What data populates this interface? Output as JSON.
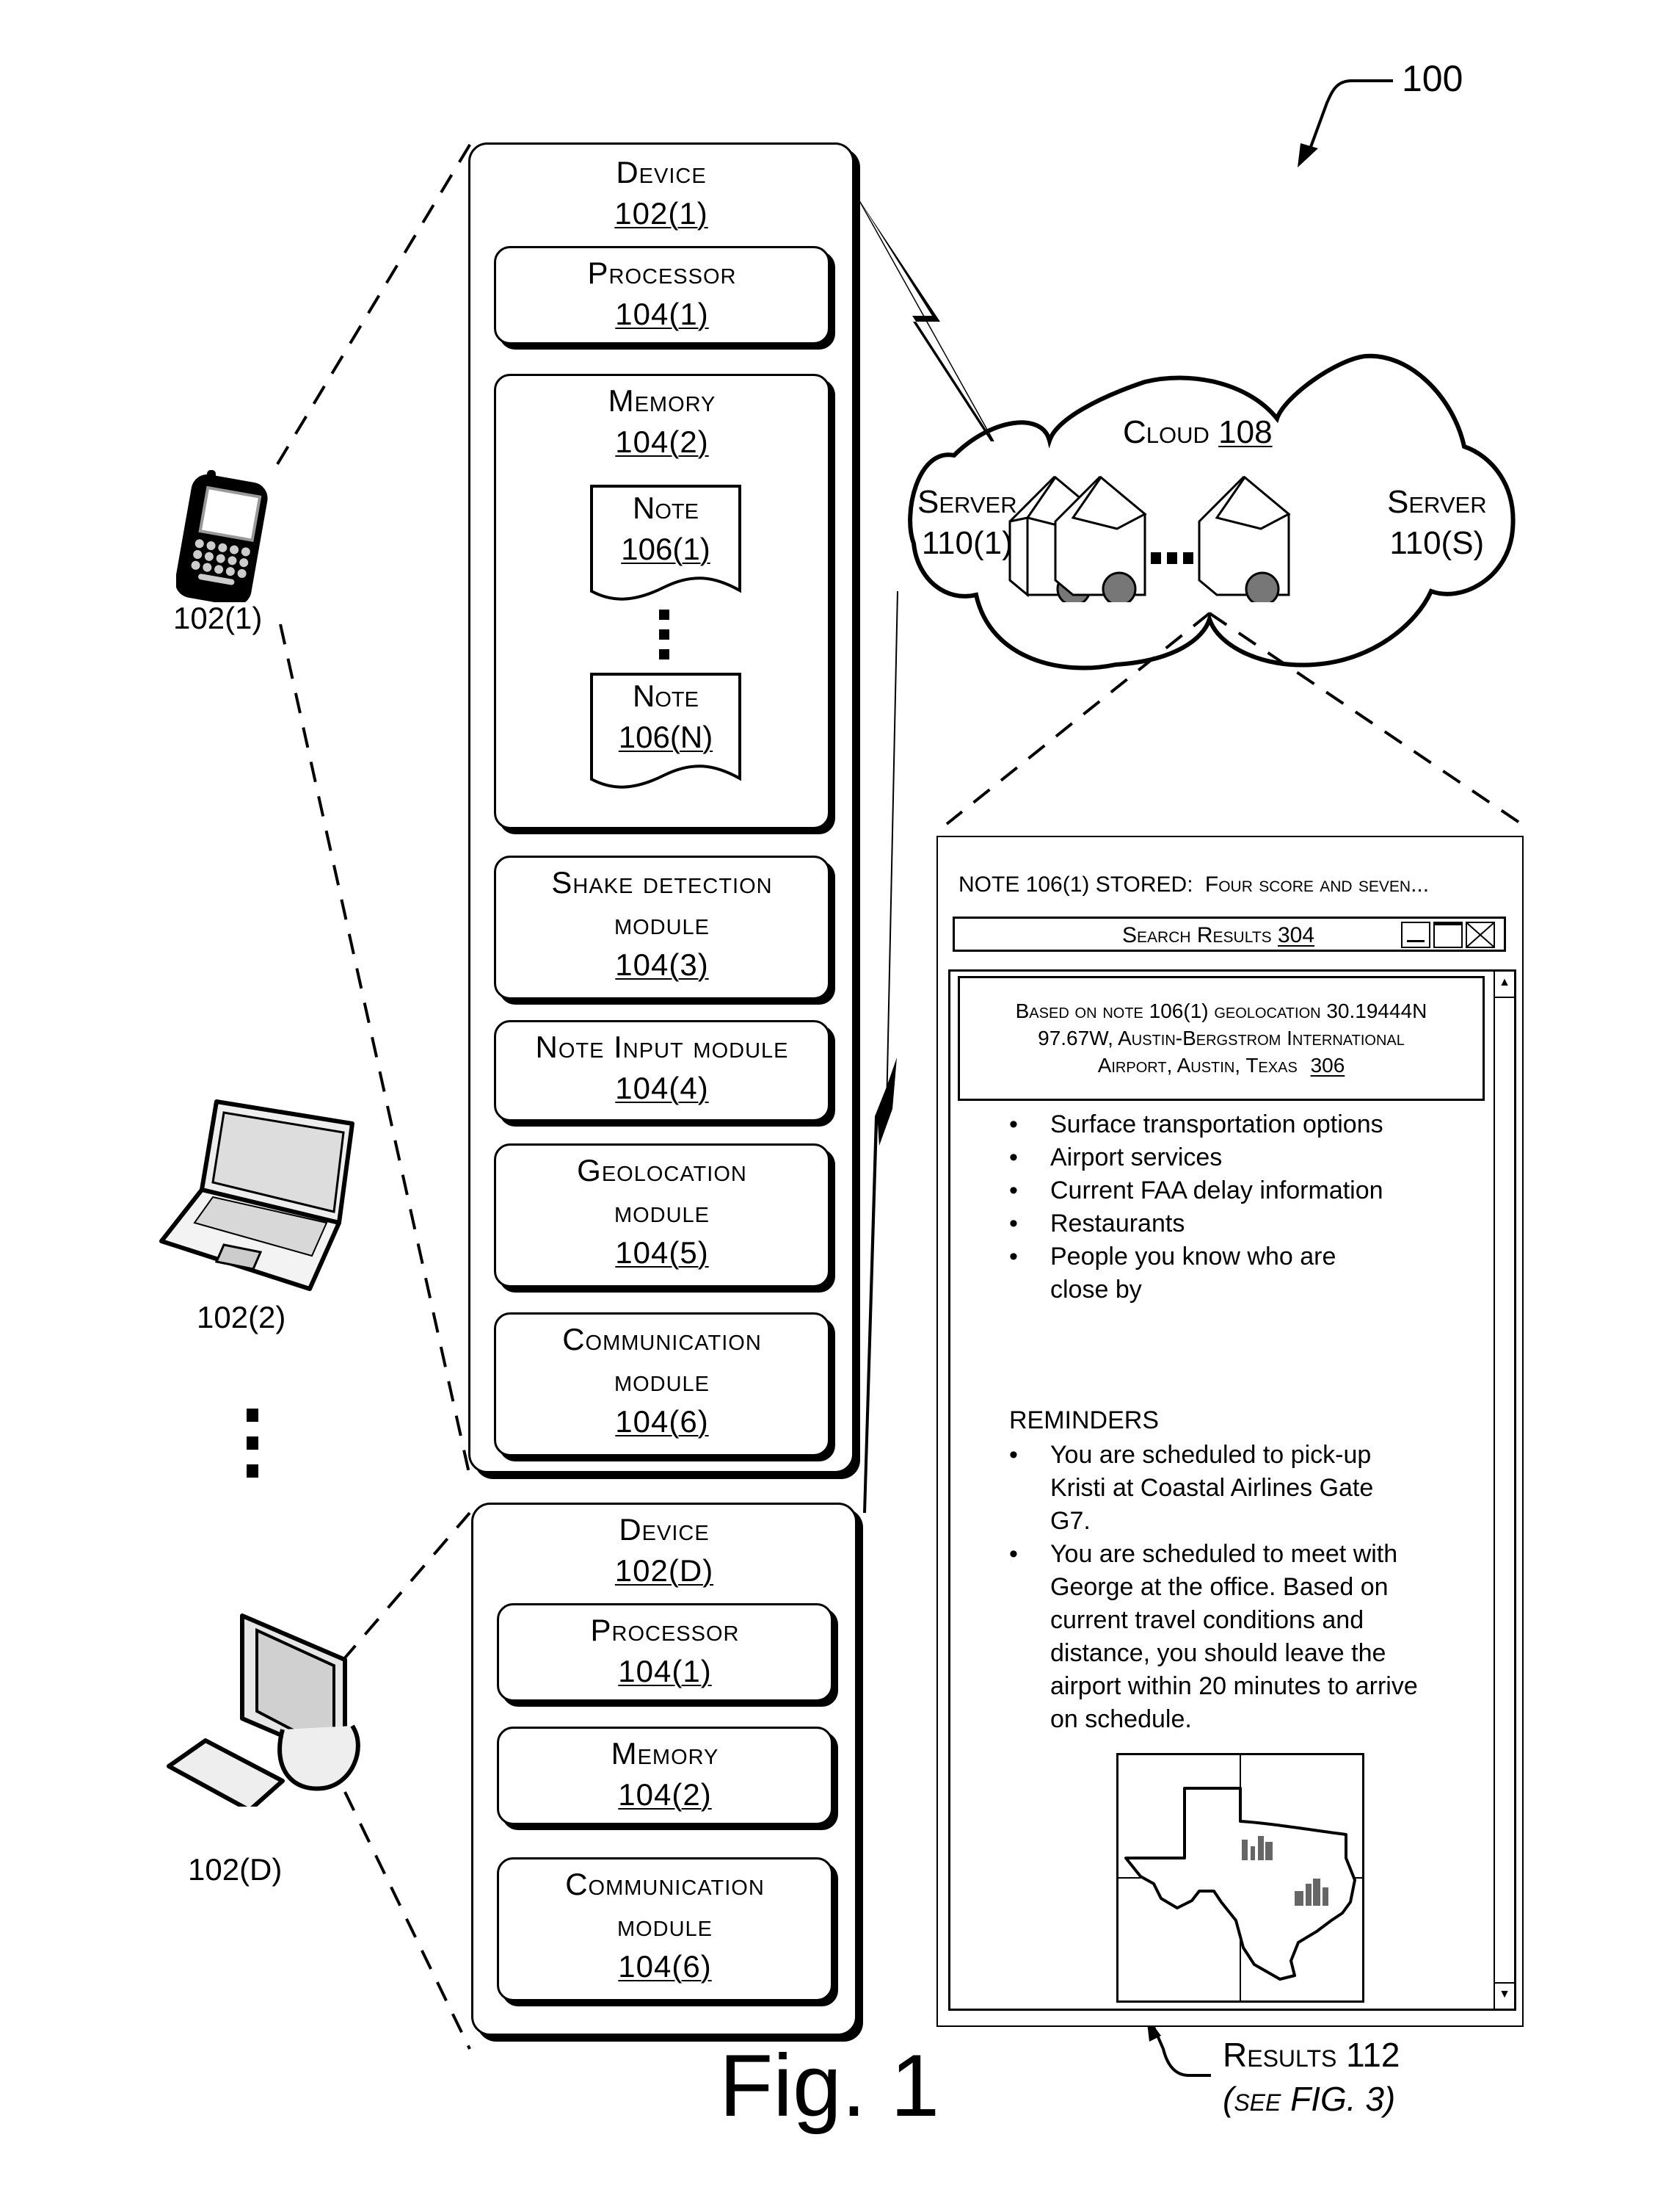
{
  "figure": {
    "ref_number": "100",
    "caption": "Fig. 1"
  },
  "client_devices": [
    {
      "label": "102(1)",
      "icon": "smartphone-icon"
    },
    {
      "label": "102(2)",
      "icon": "laptop-icon"
    },
    {
      "label": "102(D)",
      "icon": "desktop-computer-icon"
    }
  ],
  "device_1": {
    "title": "Device",
    "ref": "102(1)",
    "components": {
      "processor": {
        "title": "Processor",
        "ref": "104(1)"
      },
      "memory": {
        "title": "Memory",
        "ref": "104(2)",
        "notes": [
          {
            "title": "Note",
            "ref": "106(1)"
          },
          {
            "title": "Note",
            "ref": "106(N)"
          }
        ]
      },
      "shake": {
        "title_line1": "Shake detection",
        "title_line2": "module",
        "ref": "104(3)"
      },
      "note_input": {
        "title": "Note Input module",
        "ref": "104(4)"
      },
      "geolocation": {
        "title_line1": "Geolocation",
        "title_line2": "module",
        "ref": "104(5)"
      },
      "communication": {
        "title_line1": "Communication",
        "title_line2": "module",
        "ref": "104(6)"
      }
    }
  },
  "device_d": {
    "title": "Device",
    "ref": "102(D)",
    "components": {
      "processor": {
        "title": "Processor",
        "ref": "104(1)"
      },
      "memory": {
        "title": "Memory",
        "ref": "104(2)"
      },
      "communication": {
        "title_line1": "Communication",
        "title_line2": "module",
        "ref": "104(6)"
      }
    }
  },
  "cloud": {
    "title": "Cloud",
    "ref": "108",
    "server_first": {
      "title": "Server",
      "ref": "110(1)"
    },
    "server_last": {
      "title": "Server",
      "ref": "110(S)"
    }
  },
  "results": {
    "note_status_prefix": "NOTE 106(1) STORED:",
    "note_status_text": "Four score and seven...",
    "window_title": "Search Results",
    "window_ref": "304",
    "window_controls": [
      "minimize",
      "maximize",
      "close"
    ],
    "geo_line1": "Based on note 106(1) geolocation 30.19444N",
    "geo_line2": "97.67W, Austin-Bergstrom International",
    "geo_line3": "Airport, Austin, Texas",
    "geo_ref": "306",
    "options": [
      "Surface transportation options",
      "Airport services",
      "Current FAA delay information",
      "Restaurants",
      "People you know who are close by"
    ],
    "reminders_heading": "REMINDERS",
    "reminders": [
      "You are scheduled to pick-up Kristi at Coastal Airlines Gate G7.",
      "You are scheduled to meet with George at the office. Based on current travel conditions and distance, you should leave the airport within 20 minutes to arrive on schedule."
    ],
    "map_icon": "texas-map-icon",
    "callout_title": "Results 112",
    "callout_note": "(see FIG. 3)"
  }
}
